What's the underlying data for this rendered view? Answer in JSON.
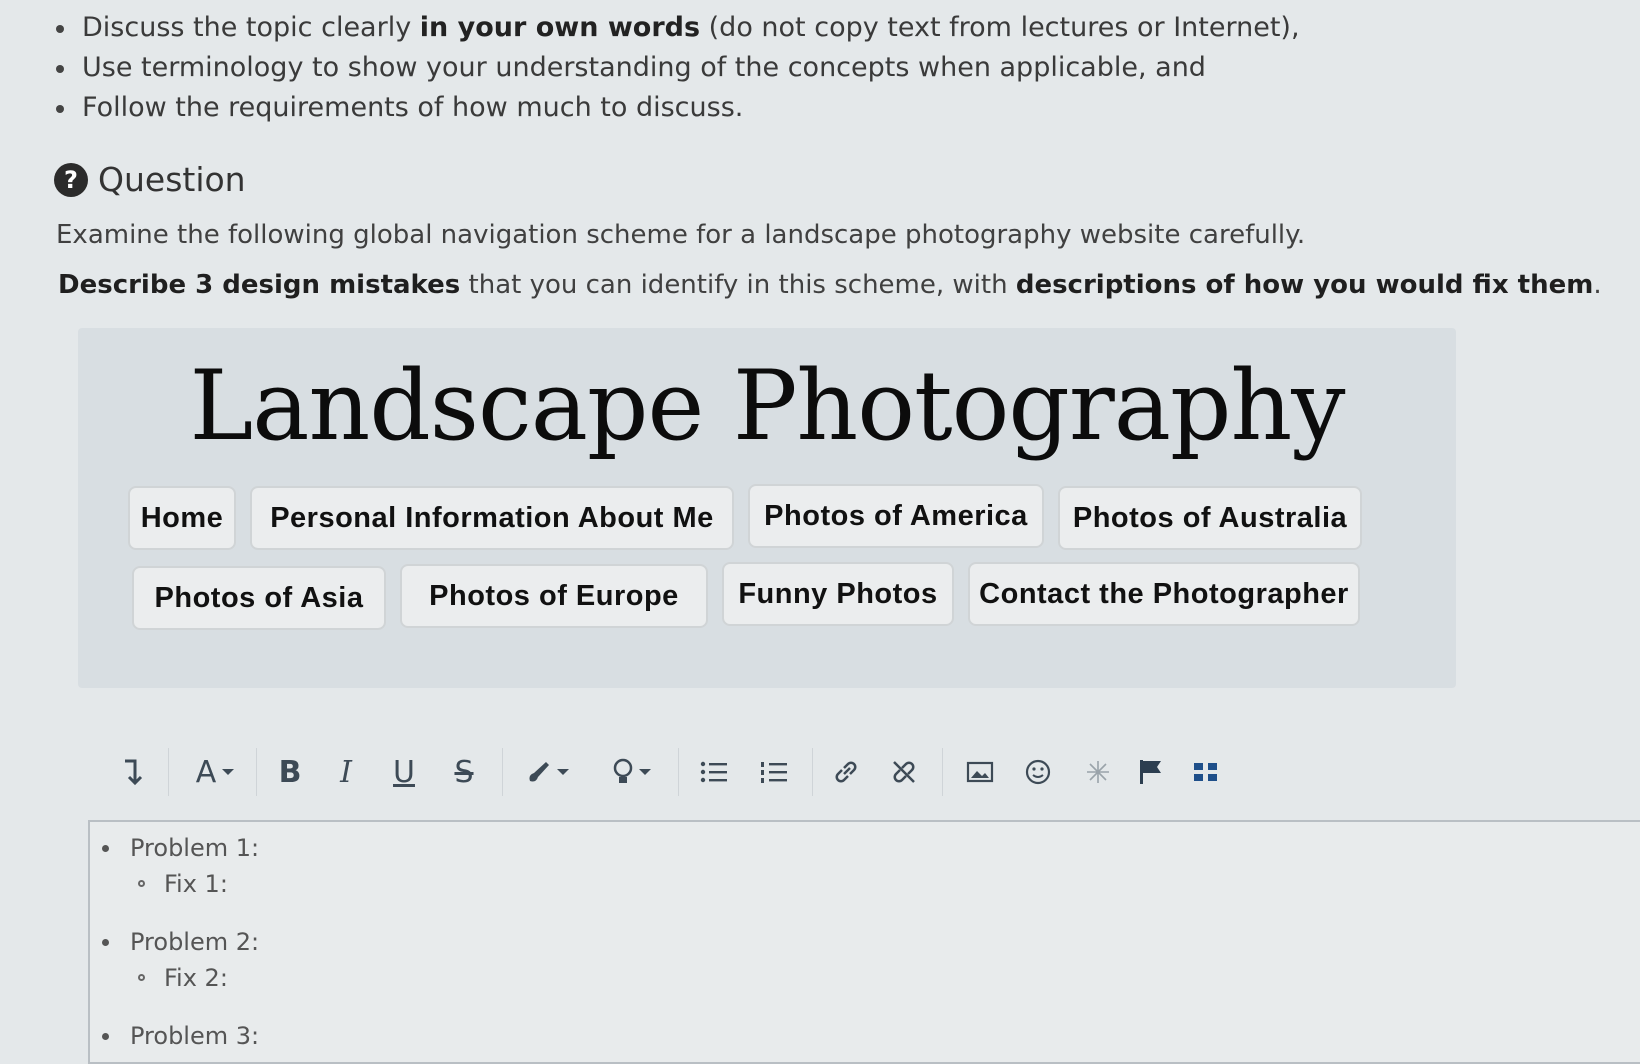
{
  "instructions": {
    "line1_a": "Discuss the topic clearly ",
    "line1_b": "in your own words",
    "line1_c": " (do not copy text from lectures or Internet),",
    "line2": "Use terminology to show your understanding of the concepts when applicable, and",
    "line3": "Follow the requirements of how much to discuss."
  },
  "question": {
    "icon": "?",
    "title": "Question",
    "prompt": "Examine the following global navigation scheme for a landscape photography website carefully.",
    "task_bold1": "Describe 3 design mistakes",
    "task_mid": " that you can identify in this scheme, with ",
    "task_bold2": "descriptions of how you would fix them",
    "task_end": "."
  },
  "figure": {
    "site_title": "Landscape Photography",
    "nav_row1": [
      "Home",
      "Personal Information About Me",
      "Photos of America",
      "Photos of Australia"
    ],
    "nav_row2": [
      "Photos of Asia",
      "Photos of Europe",
      "Funny Photos",
      "Contact the Photographer"
    ]
  },
  "toolbar": {
    "icons": [
      "paragraph-format-icon",
      "font-size-icon",
      "bold-icon",
      "italic-icon",
      "underline-icon",
      "strikethrough-icon",
      "text-color-icon",
      "highlight-icon",
      "bullet-list-icon",
      "numbered-list-icon",
      "link-icon",
      "unlink-icon",
      "image-icon",
      "emoji-icon",
      "special-char-icon",
      "flag-icon",
      "more-icon"
    ],
    "glyphs": {
      "font_size": "A",
      "bold": "B",
      "italic": "I",
      "underline": "U",
      "strike": "S"
    }
  },
  "editor": {
    "problem1": "Problem 1:",
    "fix1": "Fix 1:",
    "problem2": "Problem 2:",
    "fix2": "Fix 2:",
    "problem3": "Problem 3:"
  }
}
